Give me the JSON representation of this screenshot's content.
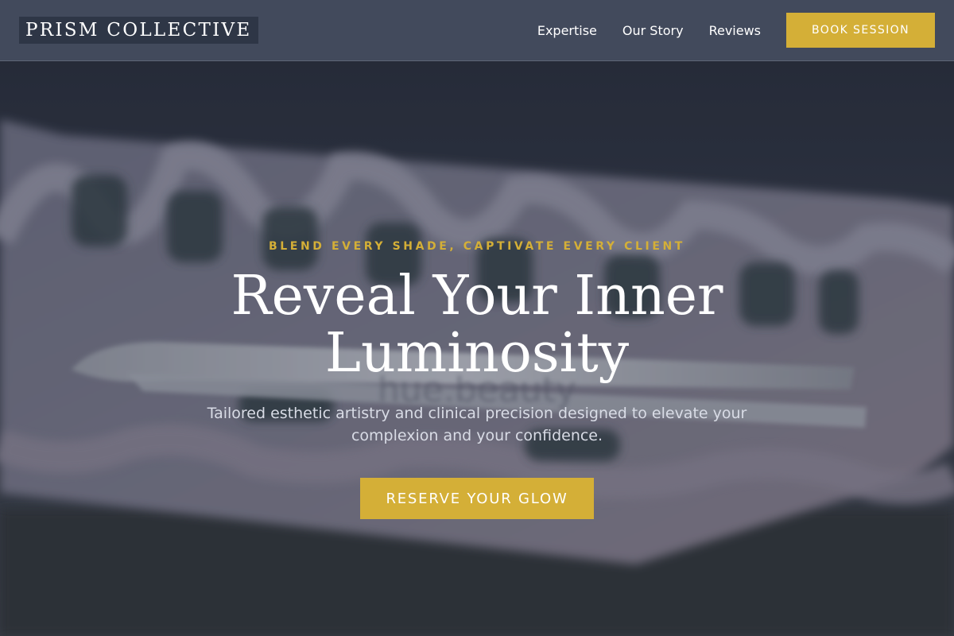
{
  "nav": {
    "logo": "PRISM COLLECTIVE",
    "links": [
      "Expertise",
      "Our Story",
      "Reviews"
    ],
    "cta_label": "BOOK SESSION"
  },
  "hero": {
    "eyebrow": "BLEND EVERY SHADE, CAPTIVATE EVERY CLIENT",
    "headline": "Reveal Your Inner Luminosity",
    "subtitle": "Tailored esthetic artistry and clinical precision designed to elevate your complexion and your confidence.",
    "cta_label": "RESERVE YOUR GLOW",
    "background_watermark": "hue.beauty"
  },
  "colors": {
    "accent": "#d4af37",
    "nav_bg": "#424a5c",
    "logo_bg": "#2e3646"
  }
}
